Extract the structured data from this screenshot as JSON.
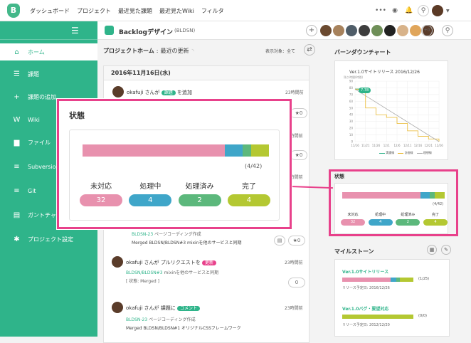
{
  "topbar": {
    "logo": "B",
    "nav": [
      "ダッシュボード",
      "プロジェクト",
      "最近見た課題",
      "最近見たWiki",
      "フィルタ"
    ],
    "more": "•••"
  },
  "sidebar": {
    "items": [
      {
        "label": "ホーム",
        "icon": "home-icon",
        "glyph": "⌂"
      },
      {
        "label": "課題",
        "icon": "list-icon",
        "glyph": "☰"
      },
      {
        "label": "課題の追加",
        "icon": "plus-icon",
        "glyph": "+"
      },
      {
        "label": "Wiki",
        "icon": "wiki-icon",
        "glyph": "W"
      },
      {
        "label": "ファイル",
        "icon": "folder-icon",
        "glyph": "▆"
      },
      {
        "label": "Subversion",
        "icon": "svn-icon",
        "glyph": "≡"
      },
      {
        "label": "Git",
        "icon": "git-icon",
        "glyph": "≡"
      },
      {
        "label": "ガントチャート",
        "icon": "gantt-icon",
        "glyph": "▤"
      },
      {
        "label": "プロジェクト設定",
        "icon": "gear-icon",
        "glyph": "✱"
      }
    ]
  },
  "project": {
    "name": "Backlogデザイン",
    "key": "(BLDSN)",
    "plus": "+",
    "count": "+0"
  },
  "main": {
    "title": "プロジェクトホーム",
    "subtitle": "最近の更新",
    "display_label": "表示対象：全て",
    "date": "2016年11月16日(水)",
    "feed": [
      {
        "user": "okafuji",
        "action": "さんが",
        "badge": "課題",
        "badge_color": "#2fb48a",
        "tail": "を追加",
        "time": "23時間前",
        "star": "0"
      },
      {
        "time": "23時間前",
        "star": "0"
      },
      {
        "time": "23時間前",
        "star": "0"
      },
      {
        "link": "BLDSN-23",
        "link_text": "ページコーディング作成",
        "line": "Merged BLDSN/BLDSN#3 mixinを他のサービスと同期"
      },
      {
        "user": "okafuji",
        "action": "さんが",
        "tail": "プルリクエストを",
        "badge": "更新",
        "badge_color": "#e8418b",
        "time": "23時間前",
        "link": "BLDSN/BLDSN#3",
        "link_text": "mixinを他のサービスと同期",
        "line": "[ 状態: Merged ]",
        "star": "0"
      },
      {
        "user": "okafuji",
        "action": "さんが",
        "tail": "課題に",
        "badge": "コメント",
        "badge_color": "#2fb48a",
        "time": "23時間前",
        "link": "BLDSN-23",
        "link_text": "ページコーディング作成",
        "line": "Merged BLDSN/BLDSN#1 オリジナルCSSフレームワーク"
      }
    ]
  },
  "burndown": {
    "title": "バーンダウンチャート",
    "chart_title": "Ver.1.0サイトリリース 2016/12/26",
    "ylabel": "残り時間(時間)",
    "badge": "7.78",
    "legend": [
      "実績線",
      "計画線",
      "理想線"
    ]
  },
  "chart_data": {
    "type": "line",
    "title": "Ver.1.0サイトリリース 2016/12/26",
    "ylabel": "残り時間(時間)",
    "x": [
      "11/16",
      "11/21",
      "11/26",
      "12/1",
      "12/6",
      "12/11",
      "12/16",
      "12/21",
      "12/26"
    ],
    "yticks": [
      0,
      10,
      20,
      30,
      40,
      50,
      60,
      70,
      80,
      90
    ],
    "ylim": [
      0,
      90
    ],
    "series": [
      {
        "name": "実績線",
        "values": [
          78,
          78,
          78,
          78,
          78,
          78,
          78,
          78,
          78
        ]
      },
      {
        "name": "計画線",
        "values": [
          78,
          50,
          40,
          36,
          27,
          16,
          8,
          4,
          0
        ]
      },
      {
        "name": "理想線",
        "values": [
          78,
          68,
          58,
          49,
          39,
          29,
          20,
          10,
          0
        ]
      }
    ]
  },
  "status": {
    "title": "状態",
    "ratio": "(4/42)",
    "items": [
      {
        "label": "未対応",
        "value": "32",
        "color": "#e891ae"
      },
      {
        "label": "処理中",
        "value": "4",
        "color": "#3fa6c9"
      },
      {
        "label": "処理済み",
        "value": "2",
        "color": "#5cb87c"
      },
      {
        "label": "完了",
        "value": "4",
        "color": "#b4c832"
      }
    ]
  },
  "milestone": {
    "title": "マイルストーン",
    "items": [
      {
        "name": "Ver.1.0サイトリリース",
        "ratio": "(1/25)",
        "due": "リリース予定日: 2016/12/26"
      },
      {
        "name": "Ver.1.0バグ・要望対応",
        "ratio": "(0/0)",
        "due": "リリース予定日: 2012/12/20"
      }
    ]
  }
}
